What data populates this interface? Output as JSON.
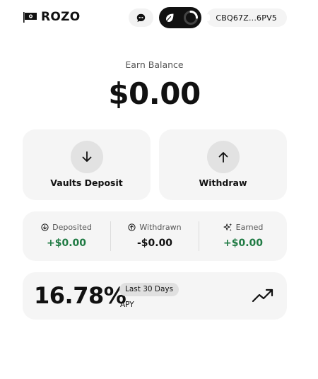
{
  "header": {
    "brand": "ROZO",
    "wallet_address": "CBQ67Z...6PV5",
    "icons": [
      "flag-icon",
      "chat-icon",
      "leaf-icon",
      "spinner-icon"
    ]
  },
  "balance": {
    "label": "Earn Balance",
    "amount": "$0.00"
  },
  "actions": {
    "deposit_label": "Vaults Deposit",
    "withdraw_label": "Withdraw"
  },
  "stats": {
    "deposited": {
      "label": "Deposited",
      "value": "+$0.00"
    },
    "withdrawn": {
      "label": "Withdrawn",
      "value": "-$0.00"
    },
    "earned": {
      "label": "Earned",
      "value": "+$0.00"
    }
  },
  "apy": {
    "value": "16.78%",
    "period": "Last 30 Days",
    "label": "APY"
  },
  "colors": {
    "positive": "#1f7a43",
    "card_bg": "#f5f5f5",
    "toggle_bg": "#111111"
  }
}
